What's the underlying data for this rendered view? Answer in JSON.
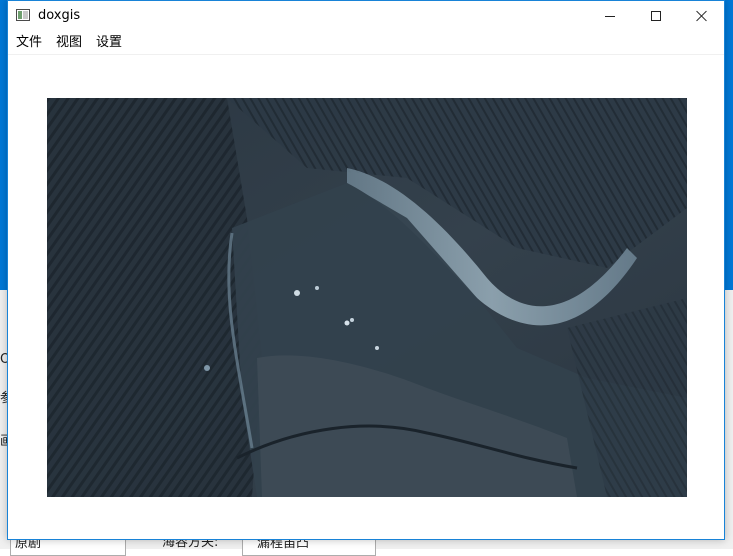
{
  "window": {
    "title": "doxgis",
    "controls": {
      "minimize": "minimize-icon",
      "maximize": "maximize-icon",
      "close": "close-icon"
    }
  },
  "menu": {
    "items": [
      {
        "label": "文件"
      },
      {
        "label": "视图"
      },
      {
        "label": "设置"
      }
    ]
  },
  "content": {
    "image_kind": "satellite-imagery"
  },
  "background_window": {
    "fragments": [
      "原剧",
      "海容方关:",
      "漏程笛凸"
    ]
  },
  "colors": {
    "accent": "#0078d7",
    "titlebar": "#ffffff",
    "imagery_dark": "#2a3640"
  }
}
